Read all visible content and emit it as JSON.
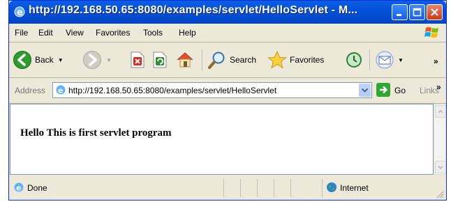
{
  "window": {
    "title": "http://192.168.50.65:8080/examples/servlet/HelloServlet - M...",
    "icons": [
      "ie-icon",
      "minimize-icon",
      "maximize-icon",
      "close-icon"
    ]
  },
  "menu": {
    "items": [
      "File",
      "Edit",
      "View",
      "Favorites",
      "Tools",
      "Help"
    ]
  },
  "toolbar": {
    "back_label": "Back",
    "search_label": "Search",
    "favorites_label": "Favorites",
    "chevron": "»"
  },
  "address": {
    "label": "Address",
    "url": "http://192.168.50.65:8080/examples/servlet/HelloServlet",
    "go_label": "Go",
    "links_label": "Links",
    "chevron": "»"
  },
  "content": {
    "text": "Hello This is first servlet program"
  },
  "status": {
    "text": "Done",
    "zone": "Internet"
  },
  "colors": {
    "titlebar": "#0450d8",
    "chrome": "#ece9d8",
    "close_button": "#c93a14"
  }
}
